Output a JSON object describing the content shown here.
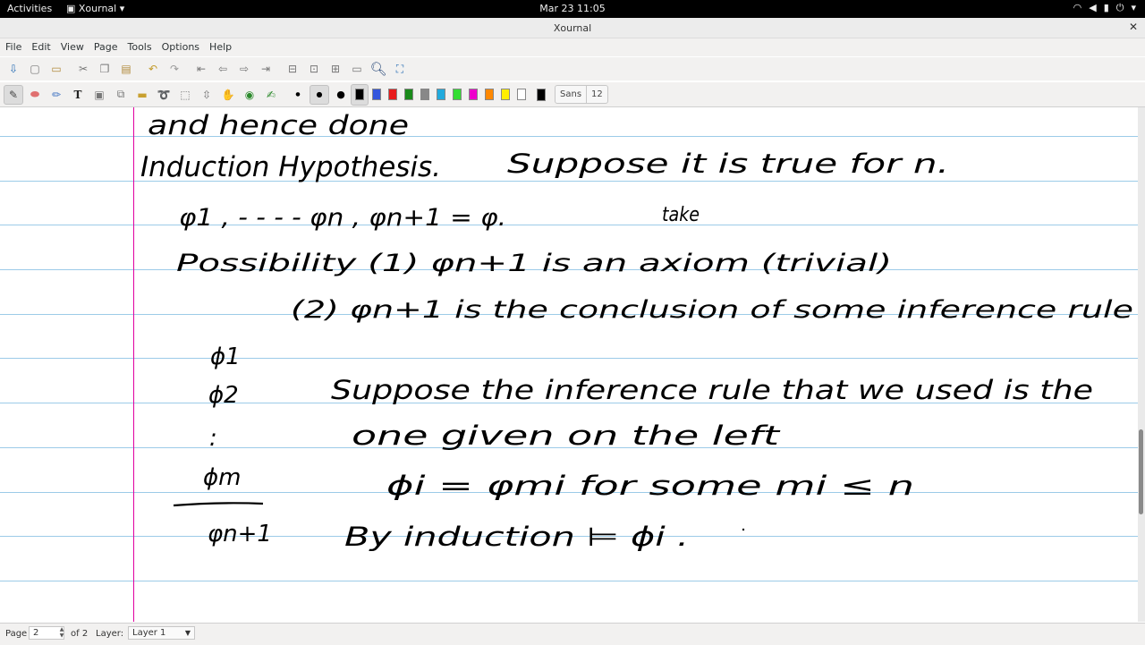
{
  "topbar": {
    "activities": "Activities",
    "app_name": "Xournal",
    "clock": "Mar 23  11:05",
    "tray_icons": [
      "wifi-icon",
      "volume-icon",
      "battery-icon",
      "power-icon"
    ]
  },
  "window": {
    "title": "Xournal",
    "close_icon": "close-icon"
  },
  "menu": [
    "File",
    "Edit",
    "View",
    "Page",
    "Tools",
    "Options",
    "Help"
  ],
  "toolbar1": {
    "icons": [
      "save-icon",
      "new-icon",
      "open-icon",
      "cut-icon",
      "copy-icon",
      "paste-icon",
      "undo-icon",
      "redo-icon",
      "first-page-icon",
      "prev-page-icon",
      "next-page-icon",
      "last-page-icon",
      "zoom-out-icon",
      "zoom-normal-icon",
      "zoom-in-icon",
      "page-width-icon",
      "zoom-icon",
      "fullscreen-icon"
    ]
  },
  "toolbar2": {
    "tools": [
      "pen-icon",
      "eraser-icon",
      "highlighter-icon",
      "text-icon",
      "image-icon",
      "shape-icon",
      "ruler-icon",
      "lasso-icon",
      "rect-select-icon",
      "vertical-space-icon",
      "hand-icon",
      "default-pen-icon",
      "shape-recognizer-icon"
    ],
    "active_tool": "pen-icon",
    "colors": [
      "#000000",
      "#3355dd",
      "#e81c1c",
      "#1a8a1a",
      "#888888",
      "#22aadd",
      "#33dd33",
      "#ee00cc",
      "#ff8800",
      "#ffee00",
      "#ffffff"
    ],
    "current_color": "#000000",
    "font_name": "Sans",
    "font_size": "12"
  },
  "status": {
    "page_label": "Page",
    "page_value": "2",
    "of_label": "of 2",
    "layer_label": "Layer:",
    "layer_value": "Layer 1"
  },
  "handwriting": [
    "and hence done",
    "Induction Hypothesis.",
    "Suppose it is true for n.",
    "φ1 , - - - - φn , φn+1 = φ.",
    "take",
    "Possibility (1) φn+1 is an axiom (trivial)",
    "(2) φn+1 is the conclusion of some inference rule",
    "ϕ1",
    "ϕ2",
    ":",
    "ϕm",
    "φn+1",
    "Suppose the inference rule that we used is the",
    "one given on the left",
    "ϕi = φmi for some mi ≤ n",
    "By induction ⊨ ϕi ."
  ]
}
